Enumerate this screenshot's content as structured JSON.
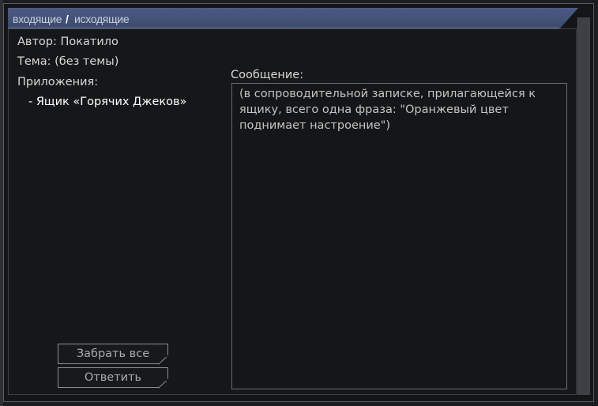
{
  "tabs": {
    "inbox": "входящие",
    "separator": "/",
    "outbox": "исходящие"
  },
  "letter": {
    "author": "Автор: Покатило",
    "subject": "Тема: (без темы)",
    "attachments_label": "Приложения:",
    "attachments": [
      "- Ящик «Горячих Джеков»"
    ],
    "message_label": "Сообщение:",
    "message_body": "(в сопроводительной записке, прилагающейся к ящику, всего одна фраза: \"Оранжевый цвет поднимает настроение\")"
  },
  "buttons": {
    "take_all": "Забрать все",
    "reply": "Ответить"
  },
  "colors": {
    "tab_accent": "#4b5b82",
    "background": "#161719",
    "text": "#d8d8d8"
  }
}
